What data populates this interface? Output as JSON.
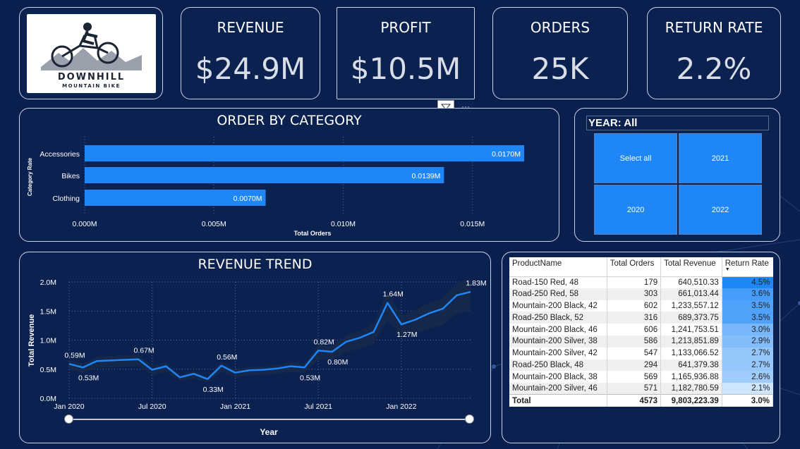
{
  "logo": {
    "name": "DOWNHILL",
    "subtitle": "MOUNTAIN BIKE"
  },
  "kpis": [
    {
      "title": "REVENUE",
      "value": "$24.9M"
    },
    {
      "title": "PROFIT",
      "value": "$10.5M"
    },
    {
      "title": "ORDERS",
      "value": "25K"
    },
    {
      "title": "RETURN RATE",
      "value": "2.2%"
    }
  ],
  "visual_header": {
    "filter_icon": "filter-icon",
    "more_label": "···"
  },
  "year_slicer": {
    "header": "YEAR: All",
    "options": [
      "Select all",
      "2021",
      "2020",
      "2022"
    ]
  },
  "trend_slider": {
    "start": 0,
    "end": 1
  },
  "chart_data": [
    {
      "type": "bar",
      "orientation": "horizontal",
      "title": "ORDER BY CATEGORY",
      "xlabel": "Total Orders",
      "ylabel": "Category Rate",
      "categories": [
        "Accessories",
        "Bikes",
        "Clothing"
      ],
      "values": [
        0.017,
        0.0139,
        0.007
      ],
      "data_labels": [
        "0.0170M",
        "0.0139M",
        "0.0070M"
      ],
      "xticks": [
        "0.000M",
        "0.005M",
        "0.010M",
        "0.015M"
      ],
      "xlim": [
        0,
        0.017
      ],
      "grid": "vertical dotted",
      "color": "#1e86f7"
    },
    {
      "type": "line",
      "title": "REVENUE TREND",
      "xlabel": "Year",
      "ylabel": "Total Revenue",
      "yticks": [
        "0.0M",
        "0.5M",
        "1.0M",
        "1.5M",
        "2.0M"
      ],
      "ylim": [
        0,
        2.0
      ],
      "xticks": [
        "Jan 2020",
        "Jul 2020",
        "Jan 2021",
        "Jul 2021",
        "Jan 2022"
      ],
      "x": [
        "2020-01",
        "2020-02",
        "2020-03",
        "2020-04",
        "2020-05",
        "2020-06",
        "2020-07",
        "2020-08",
        "2020-09",
        "2020-10",
        "2020-11",
        "2020-12",
        "2021-01",
        "2021-02",
        "2021-03",
        "2021-04",
        "2021-05",
        "2021-06",
        "2021-07",
        "2021-08",
        "2021-09",
        "2021-10",
        "2021-11",
        "2021-12",
        "2022-01",
        "2022-02",
        "2022-03",
        "2022-04",
        "2022-05",
        "2022-06"
      ],
      "values": [
        0.59,
        0.53,
        0.64,
        0.65,
        0.66,
        0.67,
        0.49,
        0.55,
        0.36,
        0.42,
        0.33,
        0.56,
        0.44,
        0.48,
        0.49,
        0.51,
        0.55,
        0.53,
        0.82,
        0.8,
        0.97,
        1.04,
        1.14,
        1.64,
        1.27,
        1.35,
        1.46,
        1.54,
        1.77,
        1.83
      ],
      "data_labels": [
        {
          "index": 0,
          "text": "0.59M",
          "pos": "above"
        },
        {
          "index": 1,
          "text": "0.53M",
          "pos": "below"
        },
        {
          "index": 5,
          "text": "0.67M",
          "pos": "above"
        },
        {
          "index": 10,
          "text": "0.33M",
          "pos": "below"
        },
        {
          "index": 11,
          "text": "0.56M",
          "pos": "above"
        },
        {
          "index": 17,
          "text": "0.53M",
          "pos": "below"
        },
        {
          "index": 18,
          "text": "0.82M",
          "pos": "above"
        },
        {
          "index": 19,
          "text": "0.80M",
          "pos": "below"
        },
        {
          "index": 23,
          "text": "1.64M",
          "pos": "above"
        },
        {
          "index": 24,
          "text": "1.27M",
          "pos": "below"
        },
        {
          "index": 29,
          "text": "1.83M",
          "pos": "above"
        }
      ],
      "grid": "dotted",
      "color": "#1e86f7",
      "band": true
    }
  ],
  "table": {
    "columns": [
      "ProductName",
      "Total Orders",
      "Total Revenue",
      "Return Rate"
    ],
    "sorted_column": "Return Rate",
    "rows": [
      {
        "name": "Road-150 Red, 48",
        "orders": "179",
        "revenue": "640,510.33",
        "rate": "4.5%",
        "heat": 1.0
      },
      {
        "name": "Road-250 Red, 58",
        "orders": "303",
        "revenue": "661,013.44",
        "rate": "3.6%",
        "heat": 0.8
      },
      {
        "name": "Mountain-200 Black, 42",
        "orders": "602",
        "revenue": "1,233,557.12",
        "rate": "3.5%",
        "heat": 0.75
      },
      {
        "name": "Road-250 Black, 52",
        "orders": "316",
        "revenue": "689,373.75",
        "rate": "3.5%",
        "heat": 0.75
      },
      {
        "name": "Mountain-200 Black, 46",
        "orders": "606",
        "revenue": "1,241,753.51",
        "rate": "3.0%",
        "heat": 0.55
      },
      {
        "name": "Mountain-200 Silver, 38",
        "orders": "586",
        "revenue": "1,213,851.89",
        "rate": "2.9%",
        "heat": 0.5
      },
      {
        "name": "Mountain-200 Silver, 42",
        "orders": "547",
        "revenue": "1,133,066.52",
        "rate": "2.7%",
        "heat": 0.4
      },
      {
        "name": "Road-250 Black, 48",
        "orders": "294",
        "revenue": "641,379.38",
        "rate": "2.7%",
        "heat": 0.4
      },
      {
        "name": "Mountain-200 Black, 38",
        "orders": "569",
        "revenue": "1,165,936.88",
        "rate": "2.6%",
        "heat": 0.35
      },
      {
        "name": "Mountain-200 Silver, 46",
        "orders": "571",
        "revenue": "1,182,780.59",
        "rate": "2.1%",
        "heat": 0.12
      }
    ],
    "total": {
      "name": "Total",
      "orders": "4573",
      "revenue": "9,803,223.39",
      "rate": "3.0%"
    }
  }
}
